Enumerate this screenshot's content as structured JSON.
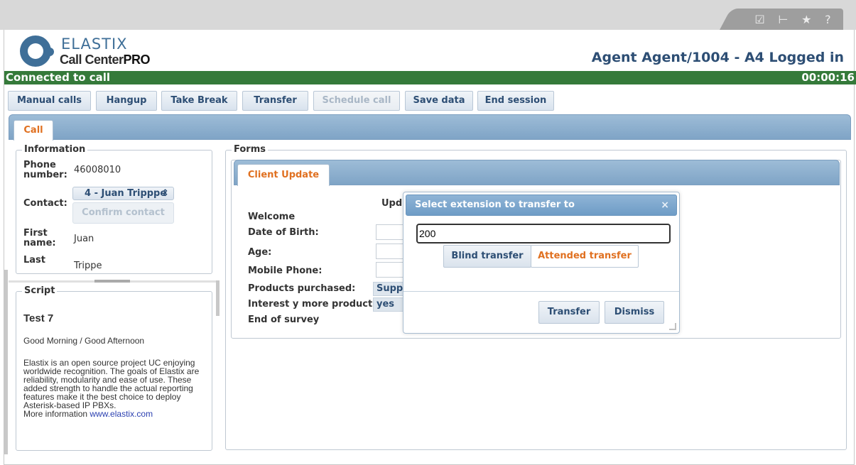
{
  "toolbar_icons": [
    "edit-icon",
    "logout-icon",
    "star-icon",
    "help-icon"
  ],
  "toolbar_icon_glyphs": [
    "☑",
    "⊢",
    "★",
    "?"
  ],
  "brand": {
    "line1": "ELASTIX",
    "line2": "Call Center",
    "line2b": "PRO"
  },
  "agent_status": "Agent Agent/1004 - A4 Logged in",
  "status": {
    "text": "Connected to call",
    "timer": "00:00:16"
  },
  "actions": [
    {
      "label": "Manual calls",
      "enabled": true
    },
    {
      "label": "Hangup",
      "enabled": true
    },
    {
      "label": "Take Break",
      "enabled": true
    },
    {
      "label": "Transfer",
      "enabled": true
    },
    {
      "label": "Schedule call",
      "enabled": false
    },
    {
      "label": "Save data",
      "enabled": true
    },
    {
      "label": "End session",
      "enabled": true
    }
  ],
  "main_tab": "Call",
  "information": {
    "legend": "Information",
    "phone_label": "Phone number:",
    "phone_value": "46008010",
    "contact_label": "Contact:",
    "contact_selected": "4 - Juan Tripppe",
    "confirm_label": "Confirm contact",
    "first_label": "First name:",
    "first_value": "Juan",
    "last_label": "Last",
    "last_value": "Trippe"
  },
  "script": {
    "legend": "Script",
    "title": "Test 7",
    "greeting": "Good Morning / Good Afternoon",
    "body": "Elastix is an open source project UC enjoying worldwide recognition. The goals of Elastix are reliability, modularity and ease of use. These added strength to handle the actual reporting features make it the best choice to deploy Asterisk-based IP PBXs.",
    "more": "More information",
    "link": "www.elastix.com"
  },
  "forms": {
    "legend": "Forms",
    "tab": "Client Update",
    "partial_header": "Upd",
    "fields": [
      "Welcome",
      "Date of Birth:",
      "Age:",
      "Mobile Phone:",
      "Products purchased:",
      "Interest y more products:",
      "End of survey"
    ],
    "products_value": "Supp",
    "interest_value": "yes"
  },
  "dialog": {
    "title": "Select extension to transfer to",
    "close": "×",
    "extension": "200",
    "blind": "Blind transfer",
    "attended": "Attended transfer",
    "transfer": "Transfer",
    "dismiss": "Dismiss"
  }
}
